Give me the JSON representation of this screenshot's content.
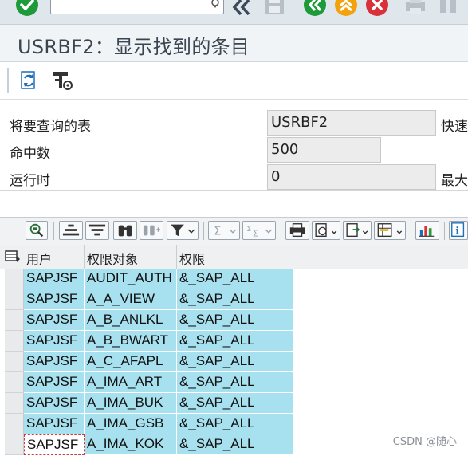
{
  "toolbar": {
    "command_field_value": ""
  },
  "title": "USRBF2：显示找到的条目",
  "info": {
    "rows": [
      {
        "label": "将要查询的表",
        "value": "USRBF2",
        "extra": "快速"
      },
      {
        "label": "命中数",
        "value": "500",
        "extra": ""
      },
      {
        "label": "运行时",
        "value": "0",
        "extra": "最大"
      }
    ]
  },
  "grid": {
    "columns": [
      "用户",
      "权限对象",
      "权限"
    ],
    "rows": [
      [
        "SAPJSF",
        "AUDIT_AUTH",
        "&_SAP_ALL"
      ],
      [
        "SAPJSF",
        "A_A_VIEW",
        "&_SAP_ALL"
      ],
      [
        "SAPJSF",
        "A_B_ANLKL",
        "&_SAP_ALL"
      ],
      [
        "SAPJSF",
        "A_B_BWART",
        "&_SAP_ALL"
      ],
      [
        "SAPJSF",
        "A_C_AFAPL",
        "&_SAP_ALL"
      ],
      [
        "SAPJSF",
        "A_IMA_ART",
        "&_SAP_ALL"
      ],
      [
        "SAPJSF",
        "A_IMA_BUK",
        "&_SAP_ALL"
      ],
      [
        "SAPJSF",
        "A_IMA_GSB",
        "&_SAP_ALL"
      ],
      [
        "SAPJSF",
        "A_IMA_KOK",
        "&_SAP_ALL"
      ]
    ]
  },
  "watermark": "CSDN @随心",
  "colors": {
    "confirm_green": "#1e9a3a",
    "back_green": "#1e9a3a",
    "exit_orange": "#f2a20c",
    "cancel_red": "#d8313a",
    "cell_highlight": "#a7e0ee"
  }
}
